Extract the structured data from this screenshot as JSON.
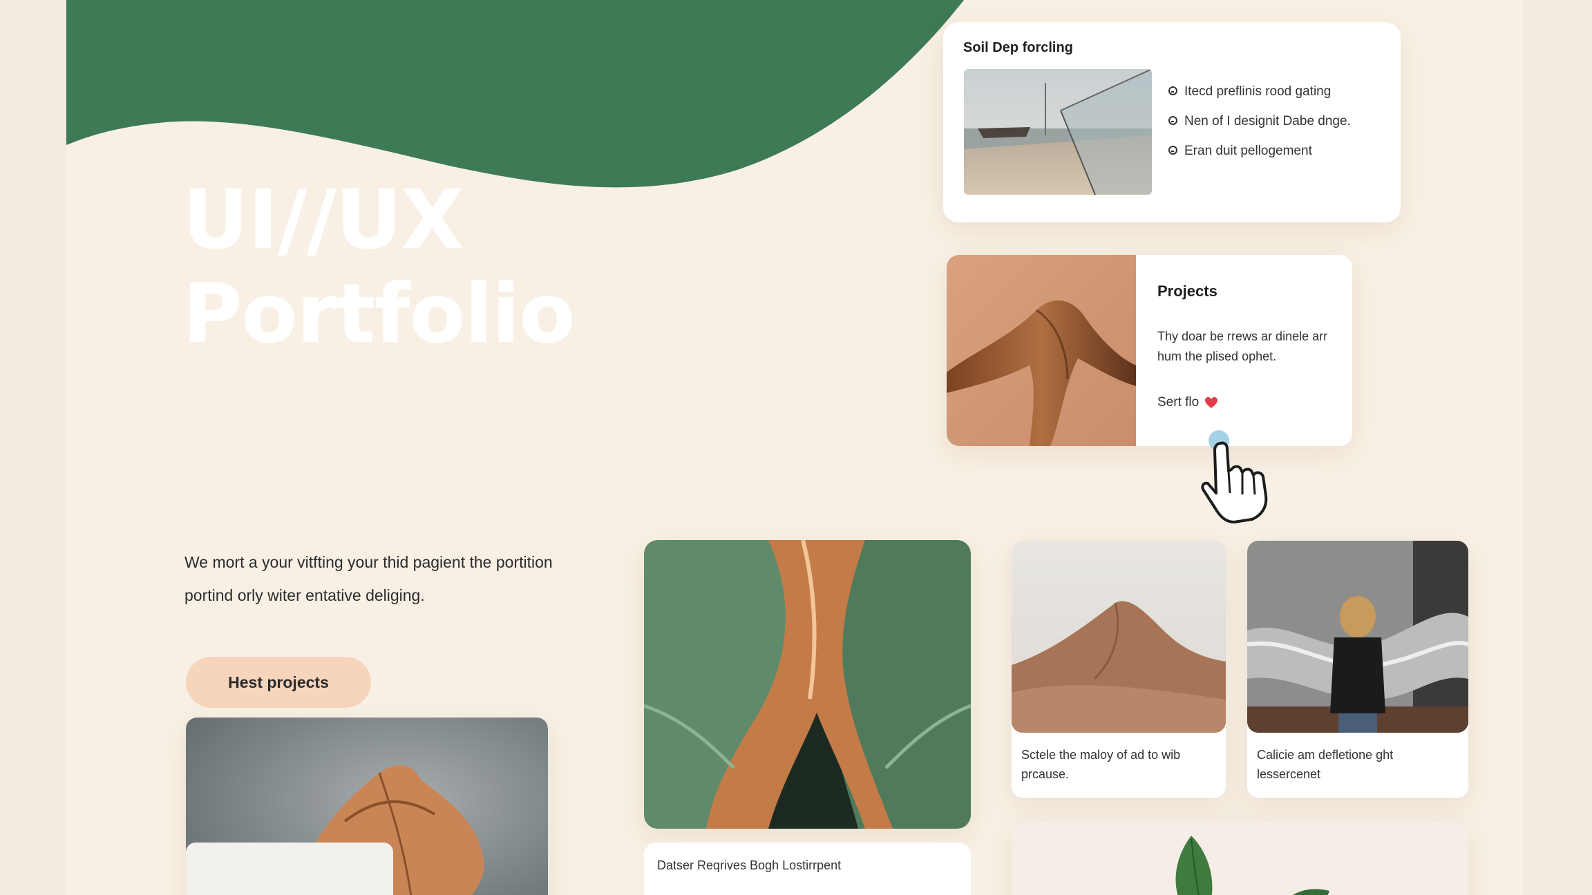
{
  "hero": {
    "line1": "UI//UX",
    "line2": "Portfolio"
  },
  "intro": {
    "text": "We mort a your vitfting your thid pagient the portition portind orly witer entative deliging."
  },
  "cta": {
    "label": "Hest projects"
  },
  "feature_card": {
    "title": "Soil Dep forcling",
    "items": [
      "Itecd preflinis rood gating",
      "Nen of I designit Dabe dnge.",
      "Eran duit pellogement"
    ]
  },
  "projects_card": {
    "title": "Projects",
    "description": "Thy doar be rrews ar dinele arr hum the plised ophet.",
    "link_label": "Sert flo"
  },
  "gallery": {
    "center_caption": "Datser Reqrives Bogh Lostirrpent",
    "desert_caption": "Sctele the maloy of ad to wib prcause.",
    "sculpture_caption": "Calicie am defletione ght lessercenet"
  },
  "colors": {
    "brand_green": "#3f7a56",
    "page_bg": "#f8f0e4",
    "cta_bg": "#f7d5bd",
    "accent_red": "#e23b4a"
  },
  "icons": [
    "check-circle-icon",
    "heart-icon",
    "hand-pointer-cursor"
  ]
}
